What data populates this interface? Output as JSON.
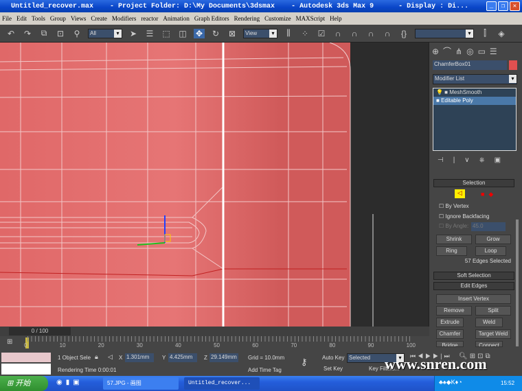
{
  "window": {
    "title": "Untitled_recover.max    - Project Folder: D:\\My Documents\\3dsmax    - Autodesk 3ds Max 9      - Display : Di..."
  },
  "menu": [
    "File",
    "Edit",
    "Tools",
    "Group",
    "Views",
    "Create",
    "Modifiers",
    "reactor",
    "Animation",
    "Graph Editors",
    "Rendering",
    "Customize",
    "MAXScript",
    "Help"
  ],
  "toolbar": {
    "selection_filter": "All",
    "ref_coord": "View",
    "named_selection": ""
  },
  "panel": {
    "object_name": "ChamferBox01",
    "object_color": "#e05050",
    "modifier_list": "Modifier List",
    "stack": [
      {
        "label": "MeshSmooth",
        "selected": false
      },
      {
        "label": "Editable Poly",
        "selected": true
      }
    ],
    "selection_rollout": "Selection",
    "by_vertex": "By Vertex",
    "ignore_backfacing": "Ignore Backfacing",
    "by_angle": "By Angle:",
    "angle_value": "45.0",
    "shrink": "Shrink",
    "grow": "Grow",
    "ring": "Ring",
    "loop": "Loop",
    "selection_status": "57 Edges Selected",
    "soft_selection": "Soft Selection",
    "edit_edges": "Edit Edges",
    "insert_vertex": "Insert Vertex",
    "remove": "Remove",
    "split": "Split",
    "extrude": "Extrude",
    "weld": "Weld",
    "chamfer": "Chamfer",
    "target_weld": "Target Weld",
    "bridge": "Bridge",
    "connect": "Connect"
  },
  "timeline": {
    "frame": "0 / 100",
    "ticks": [
      "0",
      "10",
      "20",
      "30",
      "40",
      "50",
      "60",
      "70",
      "80",
      "90",
      "100"
    ],
    "progress": 0
  },
  "status": {
    "selection": "1 Object Sele",
    "x": "1.301mm",
    "y": "4.425mm",
    "z": "29.149mm",
    "grid": "Grid = 10.0mm",
    "rendering_time": "Rendering Time  0:00:01",
    "add_time_tag": "Add Time Tag",
    "auto_key": "Auto Key",
    "set_key": "Set Key",
    "key_mode": "Selected",
    "key_filters": "Key Filters..."
  },
  "watermark": "www.snren.com",
  "taskbar": {
    "start": "开始",
    "tasks": [
      "57.JPG - 画图",
      "Untitled_recover..."
    ],
    "clock": "15:52"
  }
}
